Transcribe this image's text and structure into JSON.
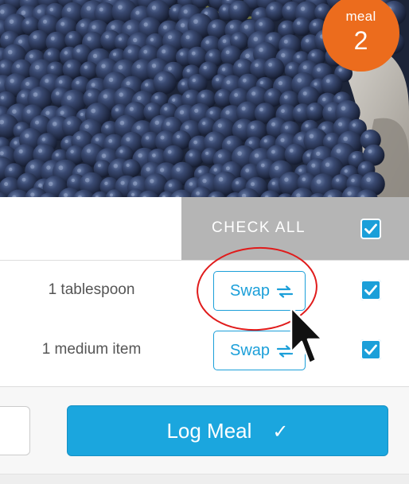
{
  "meal_badge": {
    "label": "meal",
    "number": "2",
    "color": "#ec6c1d"
  },
  "check_all": {
    "label": "CHECK ALL",
    "checked": true
  },
  "food_items": [
    {
      "amount": "1 tablespoon",
      "swap_label": "Swap",
      "checked": true
    },
    {
      "amount": "1 medium item",
      "swap_label": "Swap",
      "checked": true
    }
  ],
  "footer": {
    "log_meal_label": "Log Meal",
    "log_meal_icon": "checkmark-icon"
  },
  "colors": {
    "accent": "#1ba6de",
    "badge": "#ec6c1d",
    "highlight": "#e01b1b"
  }
}
